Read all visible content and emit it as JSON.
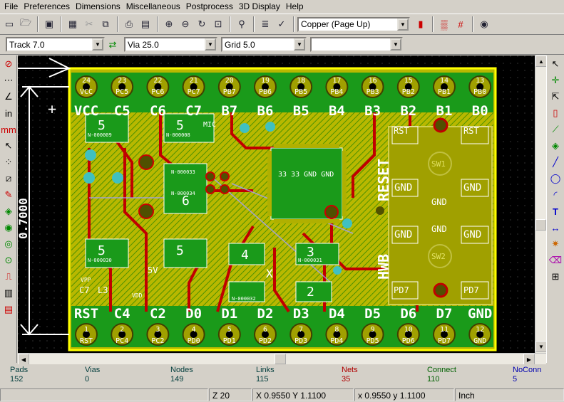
{
  "menu": [
    "File",
    "Preferences",
    "Dimensions",
    "Miscellaneous",
    "Postprocess",
    "3D Display",
    "Help"
  ],
  "toolbar": {
    "layer_select": "Copper (Page Up)"
  },
  "toolbar2": {
    "track": "Track 7.0",
    "via": "Via 25.0",
    "grid": "Grid 5.0",
    "extra": ""
  },
  "colors": {
    "board_fill": "#c8c800",
    "copper_green": "#00a000",
    "track_red": "#c00000",
    "pad_yellow": "#a0a000",
    "silk_white": "#ffffff",
    "canvas_bg": "#000000",
    "edge_yellow": "#ffff00",
    "via_blue": "#0080c0"
  },
  "board": {
    "dimension_label": "0.7000",
    "top_pin_numbers": [
      "24",
      "23",
      "22",
      "21",
      "20",
      "19",
      "18",
      "17",
      "16",
      "15",
      "14",
      "13"
    ],
    "top_pin_names": [
      "VCC",
      "PC5",
      "PC6",
      "PC7",
      "PB7",
      "PB6",
      "PB5",
      "PB4",
      "PB3",
      "PB2",
      "PB1",
      "PB0"
    ],
    "top_silk": [
      "VCC",
      "C5",
      "C6",
      "C7",
      "B7",
      "B6",
      "B5",
      "B4",
      "B3",
      "B2",
      "B1",
      "B0"
    ],
    "bottom_pin_numbers": [
      "1",
      "2",
      "3",
      "4",
      "5",
      "6",
      "7",
      "8",
      "9",
      "10",
      "11",
      "12"
    ],
    "bottom_pin_names": [
      "RST",
      "PC4",
      "PC2",
      "PD0",
      "PD1",
      "PD2",
      "PD3",
      "PD4",
      "PD5",
      "PD6",
      "PD7",
      "GND"
    ],
    "bottom_silk": [
      "RST",
      "C4",
      "C2",
      "D0",
      "D1",
      "D2",
      "D3",
      "D4",
      "D5",
      "D6",
      "D7",
      "GND"
    ],
    "reset_label": "RESET",
    "hwb_label": "HWB",
    "sw1_label": "SW1",
    "sw2_label": "SW2",
    "gnd_label": "GND",
    "rst_label": "RST",
    "pd7_label": "PD7",
    "net_labels": [
      "N-000009",
      "N-000008",
      "N-000033",
      "N-000034",
      "N-000030",
      "N-000031",
      "N-000032"
    ],
    "component_values": [
      "5",
      "5",
      "5",
      "5",
      "4",
      "3",
      "2",
      "6"
    ],
    "ic_label": "33 33 GND GND",
    "misc_silk": [
      "5V",
      "C7",
      "L3",
      "VPP",
      "VDD",
      "X",
      "MIC"
    ]
  },
  "stats": [
    {
      "label": "Pads",
      "value": "152",
      "color": "#003c3c"
    },
    {
      "label": "Vias",
      "value": "0",
      "color": "#003c3c"
    },
    {
      "label": "Nodes",
      "value": "149",
      "color": "#003c3c"
    },
    {
      "label": "Links",
      "value": "115",
      "color": "#003c3c"
    },
    {
      "label": "Nets",
      "value": "35",
      "color": "#b00000"
    },
    {
      "label": "Connect",
      "value": "110",
      "color": "#006000"
    },
    {
      "label": "NoConn",
      "value": "5",
      "color": "#0000b0"
    }
  ],
  "status": {
    "zoom": "Z 20",
    "abs_coords": "X 0.9550  Y 1.1100",
    "rel_coords": "x 0.9550  y 1.1100",
    "units": "Inch"
  }
}
